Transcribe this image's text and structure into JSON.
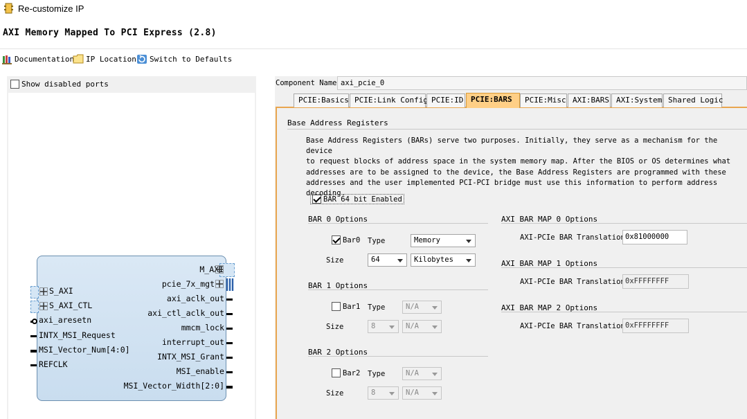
{
  "window": {
    "title": "Re-customize IP"
  },
  "ip_name": "AXI Memory Mapped To PCI Express (2.8)",
  "toolbar": {
    "documentation": "Documentation",
    "ip_location": "IP Location",
    "switch_defaults": "Switch to Defaults"
  },
  "left": {
    "show_disabled_ports": "Show disabled ports",
    "block": {
      "left_ports": [
        "S_AXI",
        "S_AXI_CTL",
        "axi_aresetn",
        "INTX_MSI_Request",
        "MSI_Vector_Num[4:0]",
        "REFCLK"
      ],
      "right_ports": [
        "M_AXI",
        "pcie_7x_mgt",
        "axi_aclk_out",
        "axi_ctl_aclk_out",
        "mmcm_lock",
        "interrupt_out",
        "INTX_MSI_Grant",
        "MSI_enable",
        "MSI_Vector_Width[2:0]"
      ]
    }
  },
  "component": {
    "label": "Component Name",
    "value": "axi_pcie_0"
  },
  "tabs": [
    "PCIE:Basics",
    "PCIE:Link Config",
    "PCIE:ID",
    "PCIE:BARS",
    "PCIE:Misc",
    "AXI:BARS",
    "AXI:System",
    "Shared Logic"
  ],
  "active_tab": "PCIE:BARS",
  "bars_page": {
    "section_title": "Base Address Registers",
    "description": [
      "Base Address Registers (BARs) serve two purposes. Initially, they serve as a mechanism for the device",
      "to request blocks of address space in the system memory map. After the BIOS or OS determines what",
      "addresses are to be assigned to the device, the Base Address Registers are programmed with these",
      "addresses and the user implemented PCI-PCI bridge must use this information to perform address",
      "decoding."
    ],
    "bar64_label": "BAR 64 bit Enabled",
    "type_label": "Type",
    "size_label": "Size",
    "bar0": {
      "title": "BAR 0 Options",
      "checkbox": "Bar0",
      "type": "Memory",
      "size": "64",
      "unit": "Kilobytes"
    },
    "bar1": {
      "title": "BAR 1 Options",
      "checkbox": "Bar1",
      "type": "N/A",
      "size": "8",
      "unit": "N/A"
    },
    "bar2": {
      "title": "BAR 2 Options",
      "checkbox": "Bar2",
      "type": "N/A",
      "size": "8",
      "unit": "N/A"
    },
    "translation_label": "AXI-PCIe BAR Translation",
    "map0": {
      "title": "AXI BAR MAP 0 Options",
      "value": "0x81000000"
    },
    "map1": {
      "title": "AXI BAR MAP 1 Options",
      "value": "0xFFFFFFFF"
    },
    "map2": {
      "title": "AXI BAR MAP 2 Options",
      "value": "0xFFFFFFFF"
    }
  }
}
